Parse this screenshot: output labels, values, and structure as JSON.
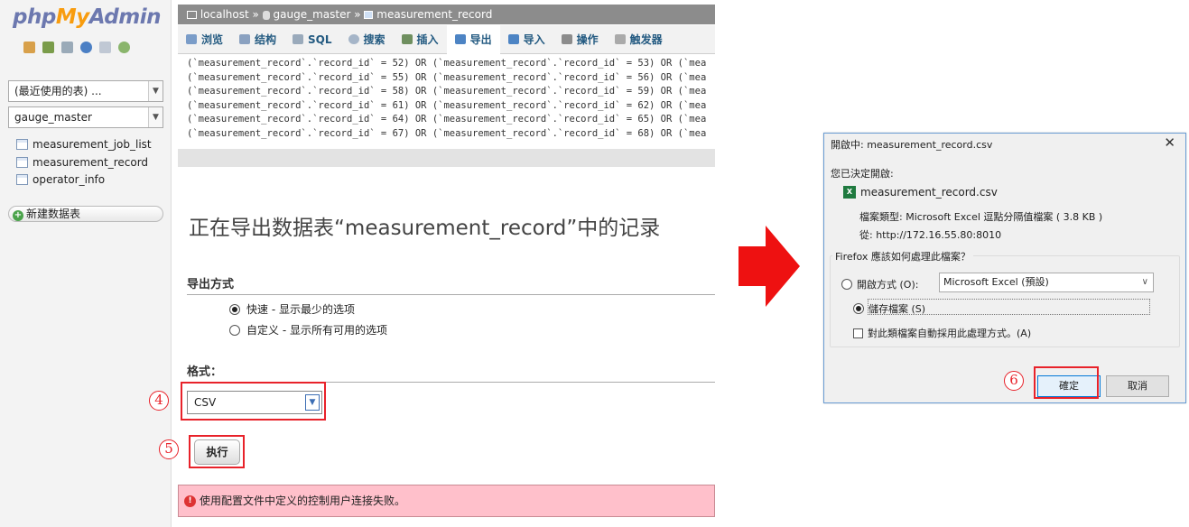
{
  "pma": {
    "logo": {
      "part1": "php",
      "part2": "My",
      "part3": "Admin"
    },
    "sidebar_icons": [
      "home-icon",
      "db-icon",
      "sql-icon",
      "help-icon",
      "docs-icon",
      "settings-icon"
    ],
    "recent_tables": "(最近使用的表) ...",
    "database_select": "gauge_master",
    "tables": [
      "measurement_job_list",
      "measurement_record",
      "operator_info"
    ],
    "new_table": "新建数据表",
    "breadcrumb": {
      "server": "localhost",
      "sep": "»",
      "database": "gauge_master",
      "table": "measurement_record"
    },
    "tabs": [
      {
        "label": "浏览",
        "icon": "browse-icon",
        "color": "#7a9cc8"
      },
      {
        "label": "结构",
        "icon": "structure-icon",
        "color": "#8aa1c0"
      },
      {
        "label": "SQL",
        "icon": "sql-icon",
        "color": "#9aaabb"
      },
      {
        "label": "搜索",
        "icon": "search-icon",
        "color": "#a5b5c8"
      },
      {
        "label": "插入",
        "icon": "insert-icon",
        "color": "#6f8f5f"
      },
      {
        "label": "导出",
        "icon": "export-icon",
        "color": "#4d84c4"
      },
      {
        "label": "导入",
        "icon": "import-icon",
        "color": "#4d84c4"
      },
      {
        "label": "操作",
        "icon": "operations-icon",
        "color": "#8c8c8c"
      },
      {
        "label": "触发器",
        "icon": "triggers-icon",
        "color": "#aaaaaa"
      }
    ],
    "sql_lines": [
      "(`measurement_record`.`record_id` = 52) OR (`measurement_record`.`record_id` = 53) OR (`mea",
      "(`measurement_record`.`record_id` = 55) OR (`measurement_record`.`record_id` = 56) OR (`mea",
      "(`measurement_record`.`record_id` = 58) OR (`measurement_record`.`record_id` = 59) OR (`mea",
      "(`measurement_record`.`record_id` = 61) OR (`measurement_record`.`record_id` = 62) OR (`mea",
      "(`measurement_record`.`record_id` = 64) OR (`measurement_record`.`record_id` = 65) OR (`mea",
      "(`measurement_record`.`record_id` = 67) OR (`measurement_record`.`record_id` = 68) OR (`mea"
    ],
    "export_title": "正在导出数据表“measurement_record”中的记录",
    "export_method_heading": "导出方式",
    "method_quick": "快速 - 显示最少的选项",
    "method_custom": "自定义 - 显示所有可用的选项",
    "format_heading": "格式：",
    "format_value": "CSV",
    "go_label": "执行",
    "error_message": "使用配置文件中定义的控制用户连接失败。"
  },
  "steps": {
    "s4": "4",
    "s5": "5",
    "s6": "6"
  },
  "colors": {
    "annotation_red": "#e8222a",
    "arrow_red": "#ee1111",
    "error_bg": "#ffc0cb"
  },
  "dialog": {
    "title": "開啟中: measurement_record.csv",
    "close": "✕",
    "decided": "您已決定開啟:",
    "filename": "measurement_record.csv",
    "file_type": "檔案類型: Microsoft Excel 逗點分隔值檔案 ( 3.8 KB )",
    "from": "從: http://172.16.55.80:8010",
    "question": "Firefox 應該如何處理此檔案？",
    "open_with": "開啟方式 (O):",
    "open_with_app": "Microsoft Excel (預設)",
    "save_file": "儲存檔案 (S)",
    "auto_apply": "對此類檔案自動採用此處理方式。(A)",
    "ok": "確定",
    "cancel": "取消"
  }
}
